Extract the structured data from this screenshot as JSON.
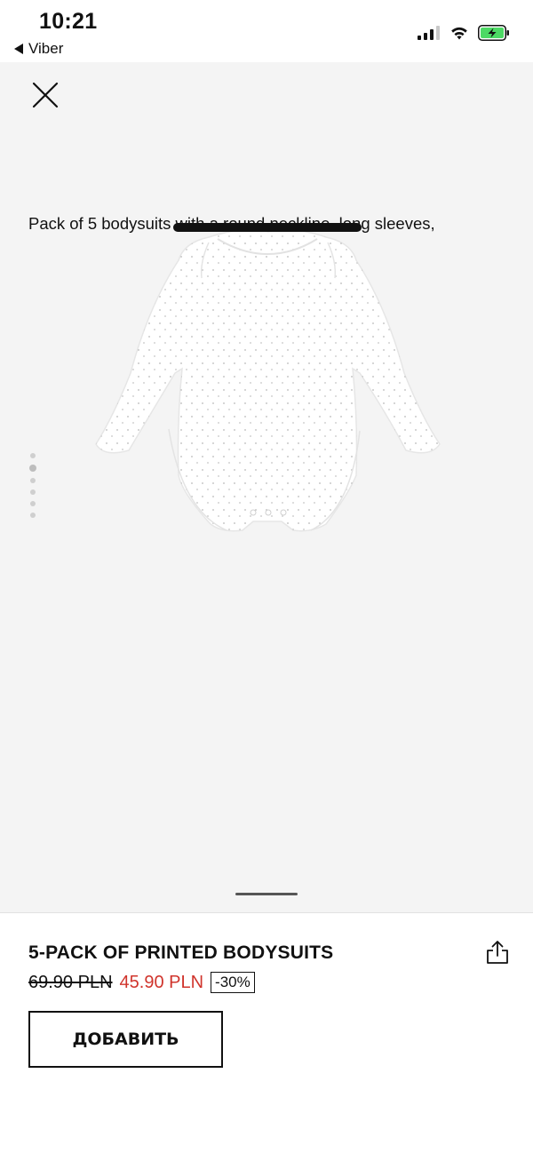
{
  "status_bar": {
    "time": "10:21",
    "back_app": "Viber"
  },
  "gallery": {
    "image_count": 6,
    "active_index": 1,
    "product_image": "white-long-sleeve-bodysuit-with-dot-print"
  },
  "product": {
    "title": "5-PACK OF PRINTED BODYSUITS",
    "old_price": "69.90 PLN",
    "new_price": "45.90 PLN",
    "discount": "-30%",
    "add_button": "ДОБАВИТЬ",
    "description": "Pack of 5 bodysuits with a round neckline, long sleeves,"
  },
  "colors": {
    "sale_red": "#d0342c",
    "battery_green": "#4cd964",
    "gallery_bg": "#f4f4f4"
  }
}
